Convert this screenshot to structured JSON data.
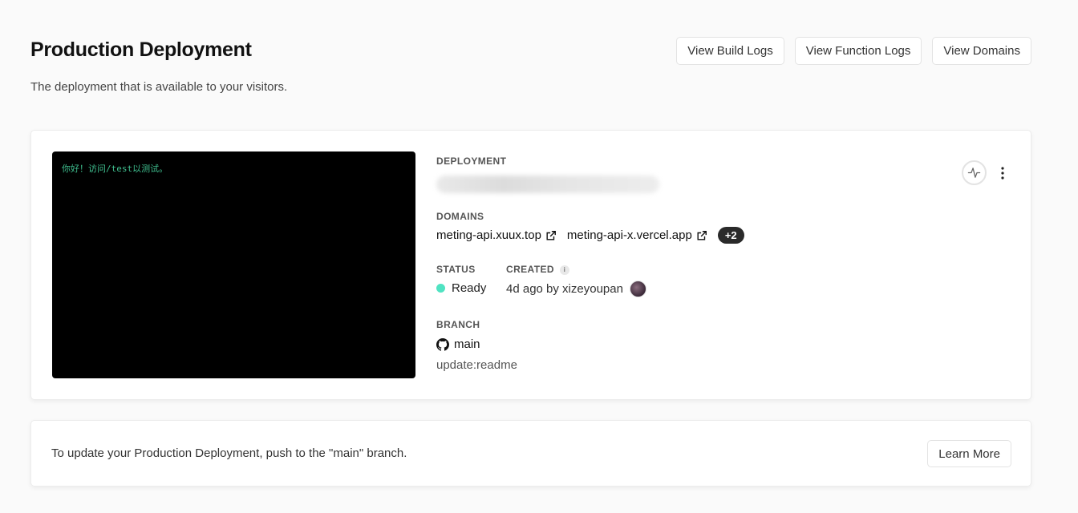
{
  "header": {
    "title": "Production Deployment",
    "subtitle": "The deployment that is available to your visitors.",
    "actions": {
      "build_logs": "View Build Logs",
      "function_logs": "View Function Logs",
      "domains": "View Domains"
    }
  },
  "deployment_card": {
    "preview_text": "你好！访问/test以测试。",
    "deployment_label": "DEPLOYMENT",
    "domains_label": "DOMAINS",
    "domains": [
      {
        "name": "meting-api.xuux.top",
        "icon": "external-link-icon"
      },
      {
        "name": "meting-api-x.vercel.app",
        "icon": "external-link-icon"
      }
    ],
    "more_domains_badge": "+2",
    "status_label": "STATUS",
    "status_value": "Ready",
    "status_color": "#50e3c2",
    "created_label": "CREATED",
    "created_info_icon": "i",
    "created_value": "4d ago by xizeyoupan",
    "branch_label": "BRANCH",
    "branch_icon": "github-icon",
    "branch_name": "main",
    "commit_message": "update:readme",
    "activity_icon": "activity-icon",
    "menu_icon": "more-vertical-icon"
  },
  "info_card": {
    "text": "To update your Production Deployment, push to the \"main\" branch.",
    "button_label": "Learn More"
  }
}
